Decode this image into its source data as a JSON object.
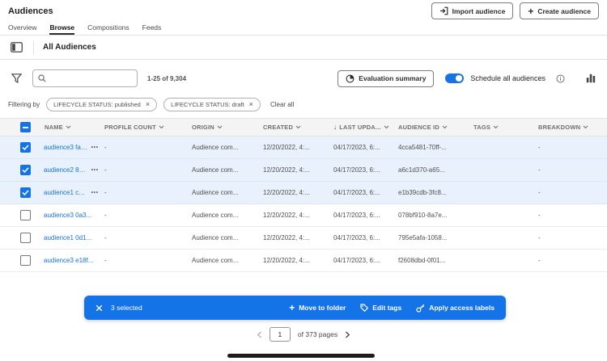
{
  "header": {
    "title": "Audiences",
    "import_button": "Import audience",
    "create_button": "Create audience"
  },
  "tabs": [
    {
      "label": "Overview",
      "active": false
    },
    {
      "label": "Browse",
      "active": true
    },
    {
      "label": "Compositions",
      "active": false
    },
    {
      "label": "Feeds",
      "active": false
    }
  ],
  "section": {
    "title": "All Audiences"
  },
  "toolbar": {
    "result_count": "1-25 of 9,304",
    "evaluation_button": "Evaluation summary",
    "schedule_label": "Schedule all audiences",
    "schedule_toggle_on": true
  },
  "filter_bar": {
    "label": "Filtering by",
    "chips": [
      "LIFECYCLE STATUS: published",
      "LIFECYCLE STATUS: draft"
    ],
    "clear_all": "Clear all"
  },
  "table": {
    "columns": [
      {
        "label": "NAME",
        "sorted": false
      },
      {
        "label": "PROFILE COUNT",
        "sorted": false
      },
      {
        "label": "ORIGIN",
        "sorted": false
      },
      {
        "label": "CREATED",
        "sorted": false
      },
      {
        "label": "LAST UPDA...",
        "sorted": true
      },
      {
        "label": "AUDIENCE ID",
        "sorted": false
      },
      {
        "label": "TAGS",
        "sorted": false
      },
      {
        "label": "BREAKDOWN",
        "sorted": false
      }
    ],
    "rows": [
      {
        "selected": true,
        "name": "audience3 fa4...",
        "profile_count": "-",
        "origin": "Audience com...",
        "created": "12/20/2022, 4:...",
        "last_updated": "04/17/2023, 6:...",
        "audience_id": "4cca5481-70ff-...",
        "tags": "",
        "breakdown": "-"
      },
      {
        "selected": true,
        "name": "audience2 863...",
        "profile_count": "-",
        "origin": "Audience com...",
        "created": "12/20/2022, 4:...",
        "last_updated": "04/17/2023, 6:...",
        "audience_id": "a6c1d370-a65...",
        "tags": "",
        "breakdown": "-"
      },
      {
        "selected": true,
        "name": "audience1 c62...",
        "profile_count": "-",
        "origin": "Audience com...",
        "created": "12/20/2022, 4:...",
        "last_updated": "04/17/2023, 6:...",
        "audience_id": "e1b39cdb-3fc8...",
        "tags": "",
        "breakdown": "-"
      },
      {
        "selected": false,
        "name": "audience3 0a3...",
        "profile_count": "-",
        "origin": "Audience com...",
        "created": "12/20/2022, 4:...",
        "last_updated": "04/17/2023, 6:...",
        "audience_id": "078bf910-8a7e...",
        "tags": "",
        "breakdown": "-"
      },
      {
        "selected": false,
        "name": "audience1 0d1...",
        "profile_count": "-",
        "origin": "Audience com...",
        "created": "12/20/2022, 4:...",
        "last_updated": "04/17/2023, 6:...",
        "audience_id": "795e5afa-1058...",
        "tags": "",
        "breakdown": "-"
      },
      {
        "selected": false,
        "name": "audience3 e18f...",
        "profile_count": "-",
        "origin": "Audience com...",
        "created": "12/20/2022, 4:...",
        "last_updated": "04/17/2023, 6:...",
        "audience_id": "f2608dbd-0f01...",
        "tags": "",
        "breakdown": "-"
      }
    ]
  },
  "action_bar": {
    "selected_label": "3 selected",
    "actions": [
      {
        "label": "Move to folder",
        "icon": "plus-icon"
      },
      {
        "label": "Edit tags",
        "icon": "tag-icon"
      },
      {
        "label": "Apply access labels",
        "icon": "key-icon"
      }
    ]
  },
  "pagination": {
    "current_page": "1",
    "total_label": "of 373 pages"
  },
  "colors": {
    "accent_blue": "#1473e6",
    "selected_row_bg": "#e9f1fc"
  }
}
